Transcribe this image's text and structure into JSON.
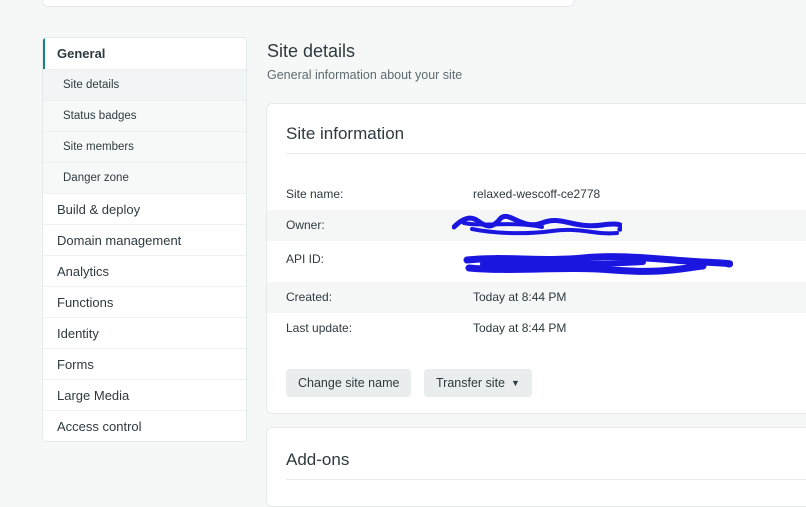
{
  "sidebar": {
    "items": [
      {
        "label": "General",
        "active": true
      },
      {
        "label": "Build & deploy"
      },
      {
        "label": "Domain management"
      },
      {
        "label": "Analytics"
      },
      {
        "label": "Functions"
      },
      {
        "label": "Identity"
      },
      {
        "label": "Forms"
      },
      {
        "label": "Large Media"
      },
      {
        "label": "Access control"
      }
    ],
    "general_subitems": [
      {
        "label": "Site details",
        "current": true
      },
      {
        "label": "Status badges"
      },
      {
        "label": "Site members"
      },
      {
        "label": "Danger zone"
      }
    ]
  },
  "main": {
    "title": "Site details",
    "subtitle": "General information about your site",
    "site_info": {
      "title": "Site information",
      "rows": {
        "site_name": {
          "label": "Site name:",
          "value": "relaxed-wescoff-ce2778"
        },
        "owner": {
          "label": "Owner:",
          "value": ""
        },
        "api_id": {
          "label": "API ID:",
          "value": ""
        },
        "created": {
          "label": "Created:",
          "value": "Today at 8:44 PM"
        },
        "last_update": {
          "label": "Last update:",
          "value": "Today at 8:44 PM"
        }
      },
      "buttons": {
        "change_site_name": "Change site name",
        "transfer_site": "Transfer site"
      }
    },
    "addons": {
      "title": "Add-ons"
    }
  },
  "colors": {
    "accent": "#15847d",
    "redaction": "#1a16e0"
  },
  "icons": {
    "transfer_dropdown": "chevron-down-icon"
  }
}
